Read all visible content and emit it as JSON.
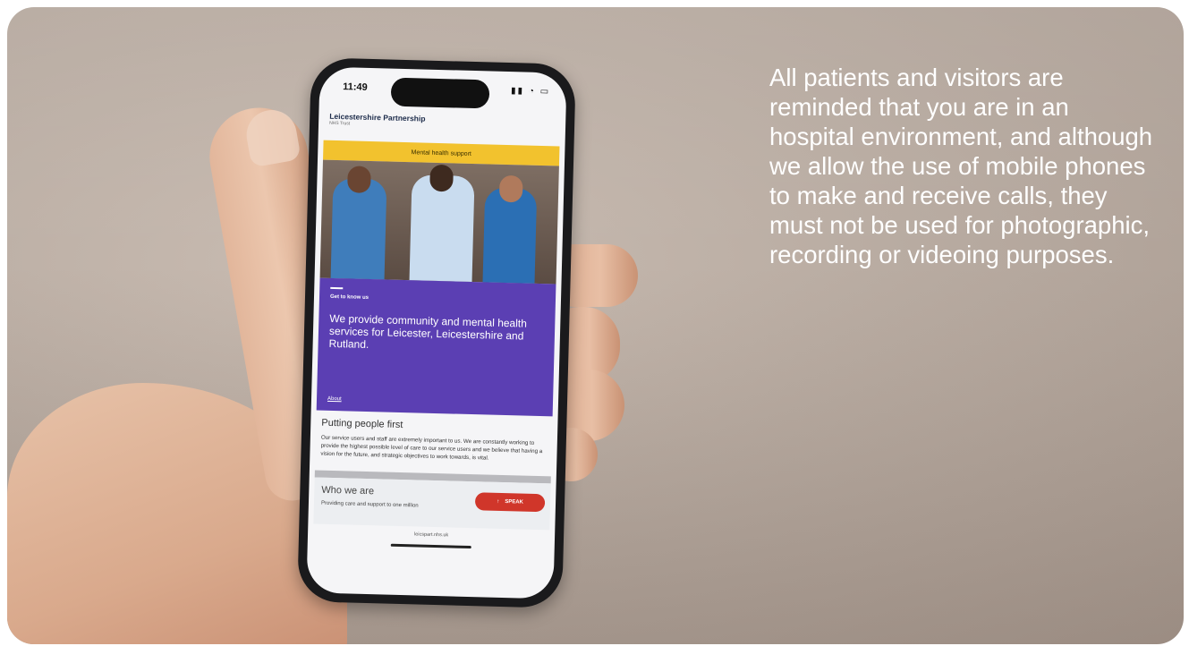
{
  "caption": "All patients and visitors are reminded that you are in an hospital environment, and although we allow the use of mobile phones to make and receive calls, they must not be used for photographic, recording or videoing purposes.",
  "phone": {
    "status_time": "11:49",
    "status_icons": "▮▮ ◔ ▭",
    "brand": "Leicestershire Partnership",
    "brand_sub": "NHS Trust",
    "banner": "Mental health support",
    "card": {
      "kicker": "Get to know us",
      "title": "We provide community and mental health services for Leicester, Leicestershire and Rutland.",
      "link": "About"
    },
    "section": {
      "heading": "Putting people first",
      "text": "Our service users and staff are extremely important to us. We are constantly working to provide the highest possible level of care to our service users and we believe that having a vision for the future, and strategic objectives to work towards, is vital."
    },
    "who": {
      "title": "Who we are",
      "text": "Providing care and support to one million"
    },
    "speak_button": "SPEAK",
    "speak_icon": "↑",
    "url": "leicspart.nhs.uk"
  },
  "colors": {
    "banner": "#f2c22e",
    "card": "#5b3fb3",
    "speak": "#d0362a"
  }
}
